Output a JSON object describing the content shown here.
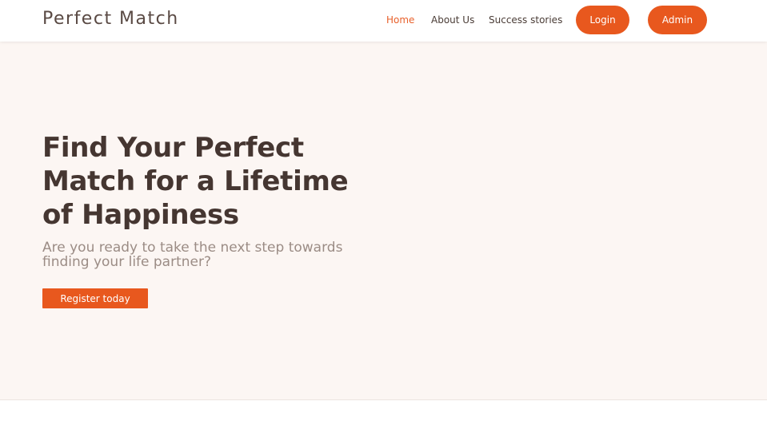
{
  "brand": {
    "name": "Perfect Match"
  },
  "nav": {
    "links": [
      {
        "label": "Home",
        "active": true
      },
      {
        "label": "About Us",
        "active": false
      },
      {
        "label": "Success stories",
        "active": false
      }
    ],
    "login_label": "Login",
    "admin_label": "Admin"
  },
  "hero": {
    "title": "Find Your Perfect Match for a Lifetime of Happiness",
    "subtitle": "Are you ready to take the next step towards finding your life partner?",
    "cta_label": "Register today"
  },
  "colors": {
    "accent": "#e8581e",
    "hero_background": "#fcf6f3",
    "heading": "#453631",
    "subtitle": "#9b8c85"
  }
}
